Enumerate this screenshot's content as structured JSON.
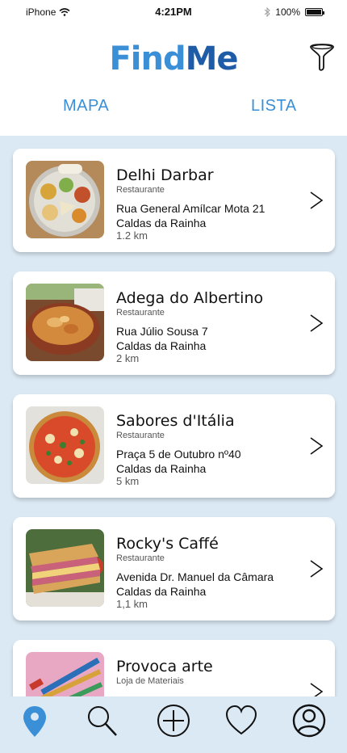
{
  "status_bar": {
    "carrier": "iPhone",
    "time": "4:21PM",
    "battery": "100%"
  },
  "header": {
    "logo_part1": "Find",
    "logo_part2": "Me",
    "tabs": [
      {
        "label": "MAPA"
      },
      {
        "label": "LISTA"
      }
    ]
  },
  "places": [
    {
      "name": "Delhi Darbar",
      "category": "Restaurante",
      "street": "Rua General Amílcar Mota 21",
      "city": "Caldas da Rainha",
      "distance": "1.2 km",
      "thumb_icon": "indian-thali-photo"
    },
    {
      "name": "Adega do Albertino",
      "category": "Restaurante",
      "street": "Rua Júlio Sousa 7",
      "city": "Caldas da Rainha",
      "distance": "2 km",
      "thumb_icon": "stew-pot-photo"
    },
    {
      "name": "Sabores d'Itália",
      "category": "Restaurante",
      "street": "Praça 5 de Outubro nº40",
      "city": "Caldas da Rainha",
      "distance": "5 km",
      "thumb_icon": "pizza-photo"
    },
    {
      "name": "Rocky's Caffé",
      "category": "Restaurante",
      "street": "Avenida Dr. Manuel da Câmara",
      "city": "Caldas da Rainha",
      "distance": "1,1 km",
      "thumb_icon": "sandwich-photo"
    },
    {
      "name": "Provoca arte",
      "category": "Loja de Materiais",
      "street": "",
      "city": "",
      "distance": "",
      "thumb_icon": "paint-brushes-photo"
    }
  ],
  "bottom_nav": {
    "items": [
      "map-pin-icon",
      "search-icon",
      "add-icon",
      "heart-icon",
      "profile-icon"
    ],
    "active_color": "#3a8fd6"
  }
}
